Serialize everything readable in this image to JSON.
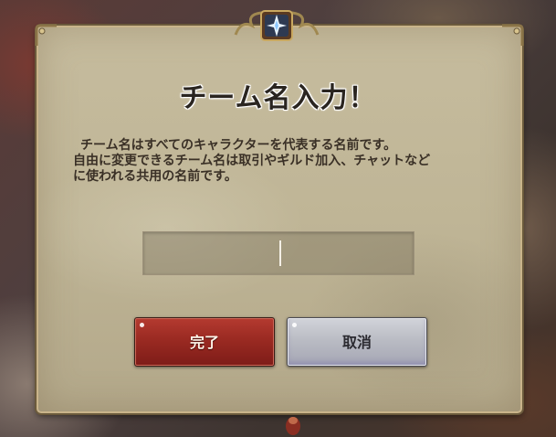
{
  "dialog": {
    "title": "チーム名入力！",
    "description": [
      "チーム名はすべてのキャラクターを代表する名前です。",
      "自由に変更できるチーム名は取引やギルド加入、チャットなど",
      "に使われる共用の名前です。"
    ],
    "name_input": {
      "value": "",
      "placeholder": ""
    },
    "confirm_label": "完了",
    "cancel_label": "取消"
  },
  "icons": {
    "crest": "compass-star-icon",
    "corners": "ornament-corner-icon"
  },
  "colors": {
    "confirm_button": "#9a2a22",
    "cancel_button": "#babcc4",
    "panel": "#c0b697",
    "panel_border": "#c9b48a"
  }
}
